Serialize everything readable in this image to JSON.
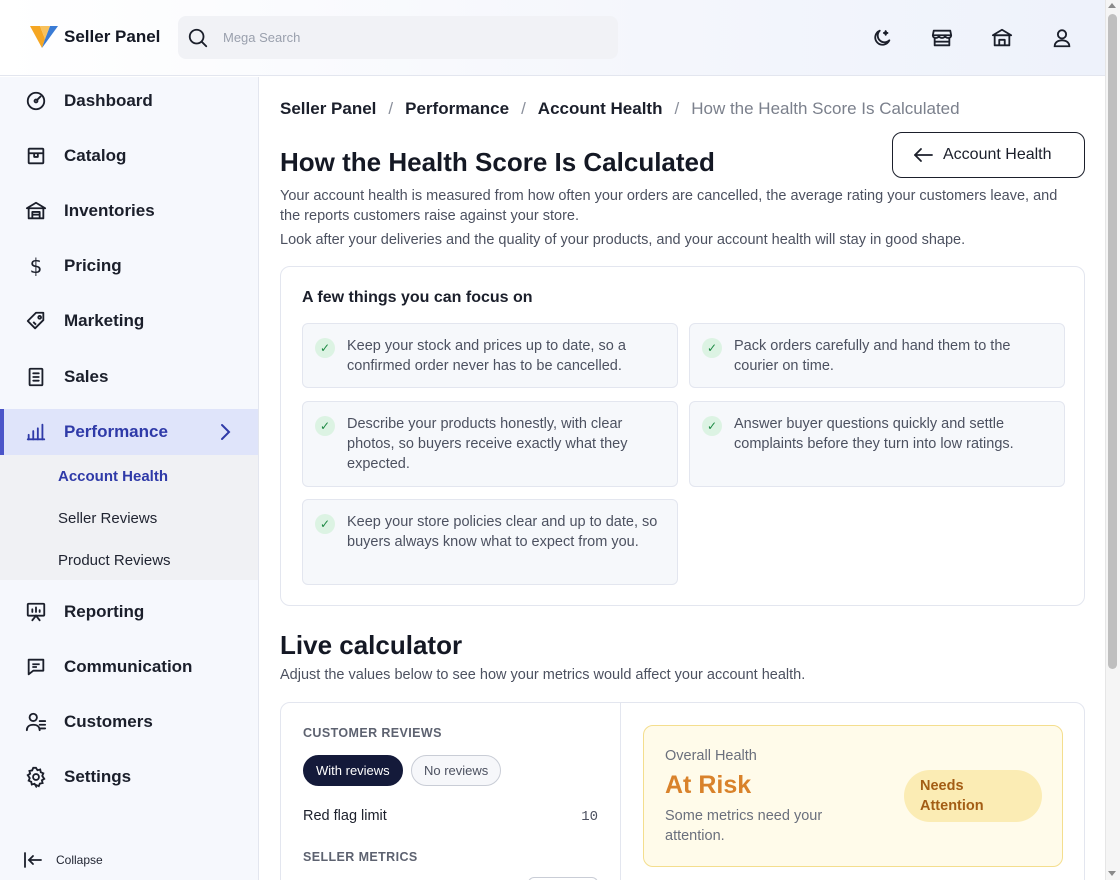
{
  "brand": {
    "name": "Seller Panel"
  },
  "search": {
    "placeholder": "Mega Search"
  },
  "sidebar": {
    "items": [
      {
        "label": "Dashboard"
      },
      {
        "label": "Catalog"
      },
      {
        "label": "Inventories"
      },
      {
        "label": "Pricing"
      },
      {
        "label": "Marketing"
      },
      {
        "label": "Sales"
      },
      {
        "label": "Performance"
      },
      {
        "label": "Reporting"
      },
      {
        "label": "Communication"
      },
      {
        "label": "Customers"
      },
      {
        "label": "Settings"
      }
    ],
    "sub_items": [
      {
        "label": "Account Health"
      },
      {
        "label": "Seller Reviews"
      },
      {
        "label": "Product Reviews"
      }
    ],
    "collapse_label": "Collapse"
  },
  "breadcrumb": {
    "items": [
      "Seller Panel",
      "Performance",
      "Account Health"
    ],
    "current": "How the Health Score Is Calculated",
    "separator": "/"
  },
  "page": {
    "title": "How the Health Score Is Calculated",
    "back_button": "Account Health",
    "intro_1": "Your account health is measured from how often your orders are cancelled, the average rating your customers leave, and the reports customers raise against your store.",
    "intro_2": "Look after your deliveries and the quality of your products, and your account health will stay in good shape."
  },
  "tips": {
    "title": "A few things you can focus on",
    "items": [
      "Keep your stock and prices up to date, so a confirmed order never has to be cancelled.",
      "Pack orders carefully and hand them to the courier on time.",
      "Describe your products honestly, with clear photos, so buyers receive exactly what they expected.",
      "Answer buyer questions quickly and settle complaints before they turn into low ratings.",
      "Keep your store policies clear and up to date, so buyers always know what to expect from you."
    ],
    "check_glyph": "✓"
  },
  "calculator": {
    "title": "Live calculator",
    "subtitle": "Adjust the values below to see how your metrics would affect your account health.",
    "reviews_label": "CUSTOMER REVIEWS",
    "toggle_on": "With reviews",
    "toggle_off": "No reviews",
    "red_flag_label": "Red flag limit",
    "red_flag_value": "10",
    "seller_metrics_label": "SELLER METRICS",
    "health": {
      "caption": "Overall Health",
      "status": "At Risk",
      "description": "Some metrics need your attention.",
      "badge": "Needs Attention"
    }
  },
  "colors": {
    "accent": "#4b55c9",
    "active_bg": "#dfe4fa",
    "warning": "#d9822b",
    "warning_bg": "#fffbea",
    "success": "#1e8a44",
    "logo_orange": "#f5a623",
    "logo_blue": "#3a7bd5"
  },
  "icons": {
    "search": "search-icon",
    "theme": "moon-icon",
    "store": "store-icon",
    "bank": "bank-icon",
    "user": "user-icon"
  }
}
